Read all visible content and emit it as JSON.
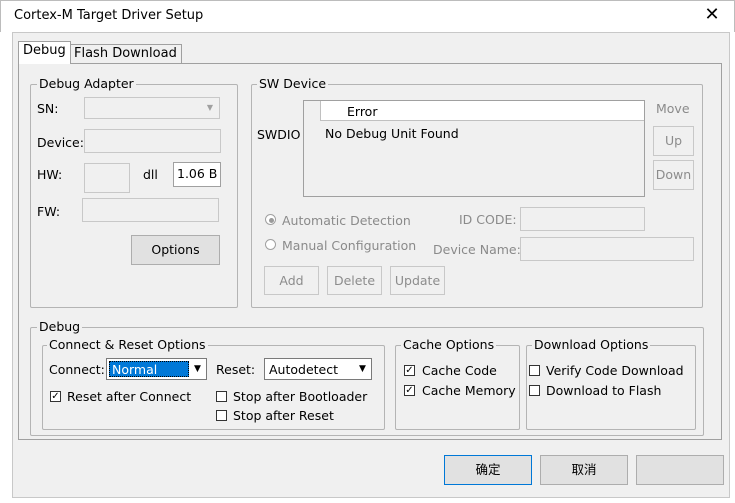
{
  "window": {
    "title": "Cortex-M Target Driver Setup",
    "close_glyph": "✕"
  },
  "tabs": [
    {
      "label": "Debug",
      "active": true
    },
    {
      "label": "Flash Download",
      "active": false
    }
  ],
  "debug_adapter": {
    "title": "Debug Adapter",
    "sn_label": "SN:",
    "device_label": "Device:",
    "hw_label": "HW:",
    "dll_label": "dll",
    "dll_value": "1.06  B",
    "fw_label": "FW:",
    "options_button": "Options"
  },
  "sw_device": {
    "title": "SW Device",
    "move_label": "Move",
    "up_button": "Up",
    "down_button": "Down",
    "swdio_label": "SWDIO",
    "table_header": "Error",
    "table_row": "No Debug Unit Found",
    "auto_detect": "Automatic Detection",
    "manual_config": "Manual Configuration",
    "id_code_label": "ID CODE:",
    "device_name_label": "Device Name:",
    "add_button": "Add",
    "delete_button": "Delete",
    "update_button": "Update"
  },
  "debug": {
    "title": "Debug",
    "connect_reset": {
      "title": "Connect & Reset Options",
      "connect_label": "Connect:",
      "connect_value": "Normal",
      "reset_label": "Reset:",
      "reset_value": "Autodetect",
      "reset_after_connect": "Reset after Connect",
      "reset_after_connect_checked": true,
      "stop_after_bootloader": "Stop after Bootloader",
      "stop_after_reset": "Stop after Reset"
    },
    "cache": {
      "title": "Cache Options",
      "cache_code": "Cache Code",
      "cache_memory": "Cache Memory"
    },
    "download": {
      "title": "Download Options",
      "verify": "Verify Code Download",
      "download_flash": "Download to Flash"
    }
  },
  "footer": {
    "ok_button": "确定",
    "cancel_button": "取消"
  }
}
